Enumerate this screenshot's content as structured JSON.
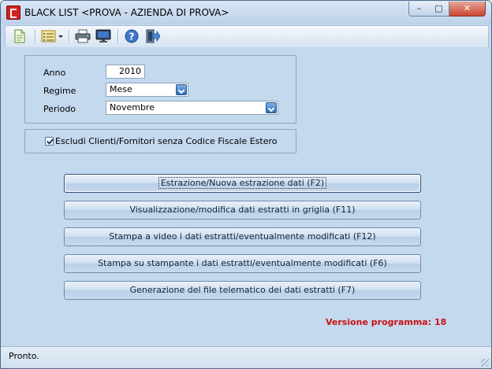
{
  "window": {
    "title": "BLACK LIST <PROVA - AZIENDA DI PROVA>",
    "controls": {
      "minimize": "–",
      "maximize": "□",
      "close": "✕"
    }
  },
  "toolbar": {
    "icons": [
      "document-icon",
      "list-dropdown-icon",
      "printer-icon",
      "monitor-icon",
      "help-icon",
      "exit-icon"
    ]
  },
  "form": {
    "anno_label": "Anno",
    "anno_value": "2010",
    "regime_label": "Regime",
    "regime_value": "Mese",
    "periodo_label": "Periodo",
    "periodo_value": "Novembre",
    "escludi_checked": true,
    "escludi_label": "Escludi Clienti/Fornitori senza Codice Fiscale Estero"
  },
  "actions": [
    {
      "label": "Estrazione/Nuova estrazione dati (F2)"
    },
    {
      "label": "Visualizzazione/modifica dati estratti in griglia (F11)"
    },
    {
      "label": "Stampa a video i dati estratti/eventualmente modificati (F12)"
    },
    {
      "label": "Stampa su stampante i dati estratti/eventualmente modificati (F6)"
    },
    {
      "label": "Generazione del file telematico dei dati estratti (F7)"
    }
  ],
  "version_text": "Versione programma: 18",
  "status": {
    "text": "Pronto."
  },
  "colors": {
    "version": "#cc1111",
    "panel": "#c4d8ee",
    "close_button": "#c9452f"
  }
}
